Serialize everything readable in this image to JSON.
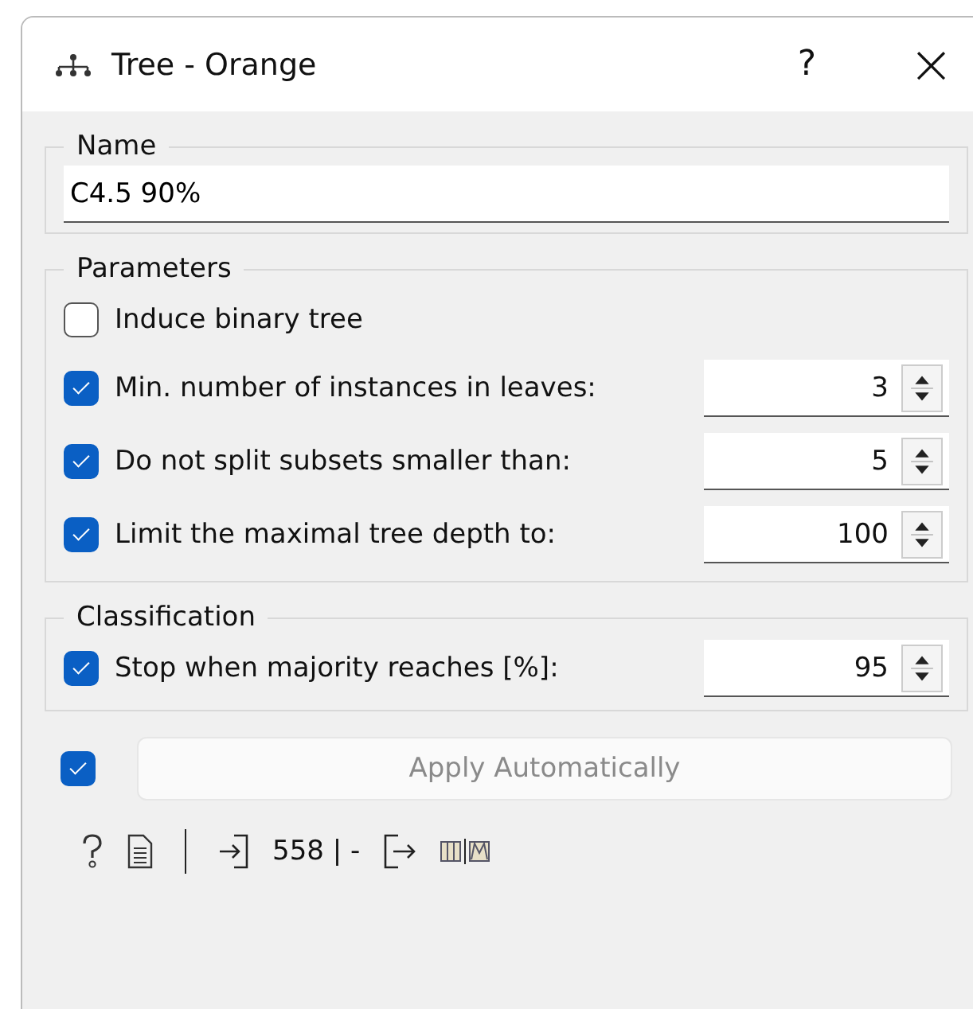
{
  "window": {
    "title": "Tree  - Orange",
    "help": "?",
    "close": "×"
  },
  "name_group": {
    "title": "Name",
    "value": "C4.5 90%"
  },
  "parameters": {
    "title": "Parameters",
    "options": [
      {
        "kind": "checkbox",
        "label": "Induce binary tree",
        "checked": false
      },
      {
        "kind": "spin",
        "label": "Min. number of instances in leaves:",
        "checked": true,
        "value": "3"
      },
      {
        "kind": "spin",
        "label": "Do not split subsets smaller than:",
        "checked": true,
        "value": "5"
      },
      {
        "kind": "spin",
        "label": "Limit the maximal tree depth to:",
        "checked": true,
        "value": "100"
      }
    ]
  },
  "classification": {
    "title": "Classification",
    "options": [
      {
        "kind": "spin",
        "label": "Stop when majority reaches [%]:",
        "checked": true,
        "value": "95"
      }
    ]
  },
  "apply": {
    "checked": true,
    "label": "Apply Automatically",
    "disabled": true
  },
  "status_bar": {
    "input_count": "558 | -"
  }
}
